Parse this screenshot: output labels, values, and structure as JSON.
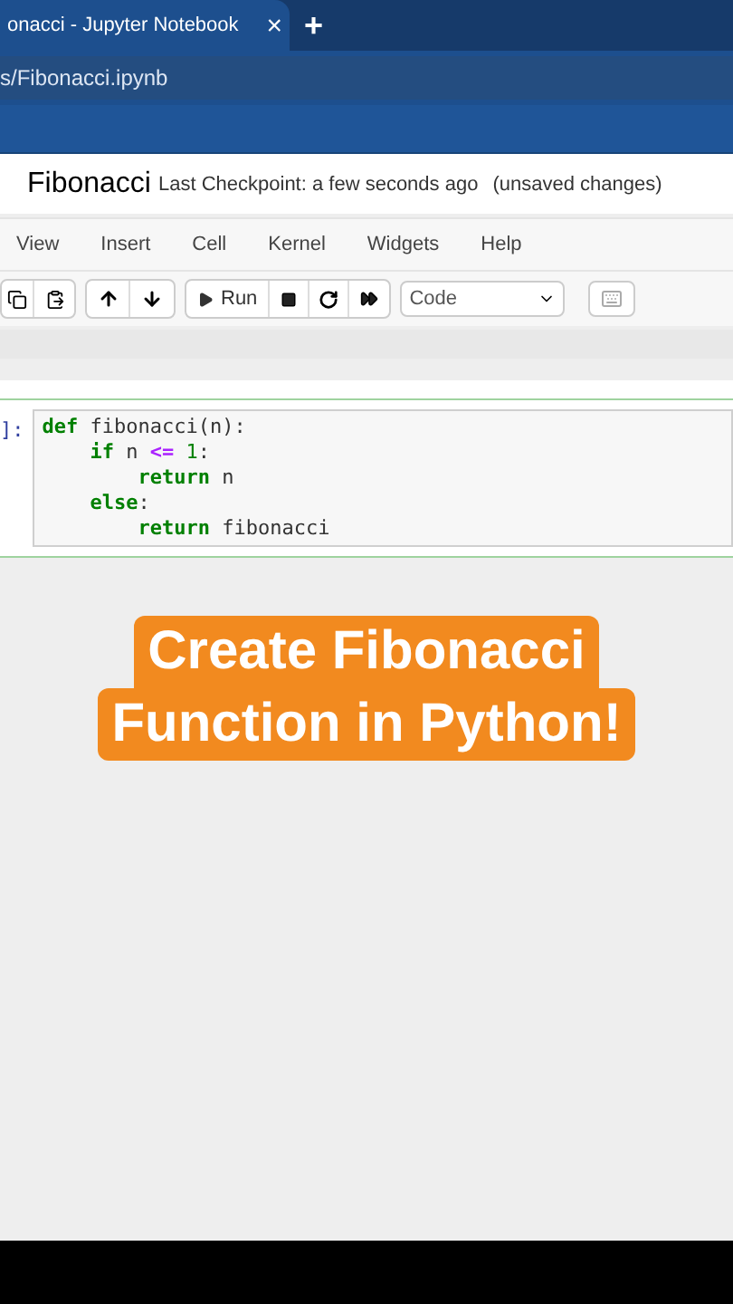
{
  "browser": {
    "tab_title": "onacci - Jupyter Notebook",
    "close": "×",
    "new_tab": "+",
    "address": "s/Fibonacci.ipynb"
  },
  "header": {
    "title": "Fibonacci",
    "checkpoint": "Last Checkpoint: a few seconds ago",
    "status": "(unsaved changes)"
  },
  "menu": [
    "View",
    "Insert",
    "Cell",
    "Kernel",
    "Widgets",
    "Help"
  ],
  "toolbar": {
    "run_label": "Run",
    "cell_type": "Code"
  },
  "cell": {
    "prompt": "]:",
    "lines": [
      [
        {
          "text": "def",
          "kind": "keyword"
        },
        {
          "text": " fibonacci(n):",
          "kind": "plain"
        }
      ],
      [
        {
          "text": "    if",
          "kind": "keyword"
        },
        {
          "text": " n ",
          "kind": "plain"
        },
        {
          "text": "<=",
          "kind": "operator"
        },
        {
          "text": " 1",
          "kind": "number"
        },
        {
          "text": ":",
          "kind": "plain"
        }
      ],
      [
        {
          "text": "        return",
          "kind": "keyword"
        },
        {
          "text": " n",
          "kind": "plain"
        }
      ],
      [
        {
          "text": "    else",
          "kind": "keyword"
        },
        {
          "text": ":",
          "kind": "plain"
        }
      ],
      [
        {
          "text": "        return",
          "kind": "keyword"
        },
        {
          "text": " fibonacci",
          "kind": "plain"
        }
      ]
    ]
  },
  "caption": [
    "Create Fibonacci",
    "Function in Python!"
  ]
}
